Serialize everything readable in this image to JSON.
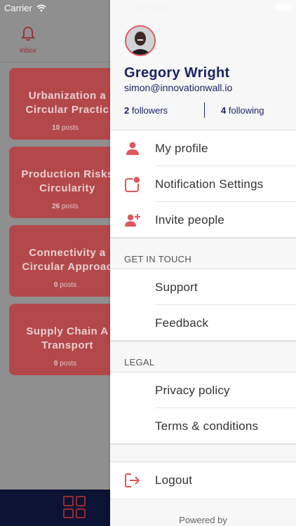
{
  "status_bar": {
    "carrier": "Carrier",
    "time": "1:32 PM"
  },
  "background": {
    "inbox_label": "inbox",
    "cards": [
      {
        "title": "Urbanization a",
        "title2": "Circular Practic",
        "posts_count": "10",
        "posts_label": "posts"
      },
      {
        "title": "Production Risks",
        "title2": "Circularity",
        "posts_count": "26",
        "posts_label": "posts"
      },
      {
        "title": "Connectivity a",
        "title2": "Circular Approac",
        "posts_count": "0",
        "posts_label": "posts"
      },
      {
        "title": "Supply Chain A",
        "title2": "Transport",
        "posts_count": "0",
        "posts_label": "posts"
      }
    ]
  },
  "drawer": {
    "profile": {
      "name": "Gregory Wright",
      "email": "simon@innovationwall.io",
      "followers_count": "2",
      "followers_label": "followers",
      "following_count": "4",
      "following_label": "following"
    },
    "menu": [
      {
        "label": "My profile",
        "icon": "person-icon"
      },
      {
        "label": "Notification Settings",
        "icon": "notification-badge-icon"
      },
      {
        "label": "Invite people",
        "icon": "add-person-icon"
      }
    ],
    "get_in_touch": {
      "title": "GET IN TOUCH",
      "items": [
        {
          "label": "Support"
        },
        {
          "label": "Feedback"
        }
      ]
    },
    "legal": {
      "title": "LEGAL",
      "items": [
        {
          "label": "Privacy policy"
        },
        {
          "label": "Terms & conditions"
        }
      ]
    },
    "logout": {
      "label": "Logout",
      "icon": "logout-icon"
    },
    "footer": {
      "powered_by": "Powered by"
    }
  },
  "colors": {
    "accent": "#e0565b",
    "navy": "#1a2563",
    "card_dimmed": "#b3484b",
    "bottom_bar": "#0c1233"
  }
}
